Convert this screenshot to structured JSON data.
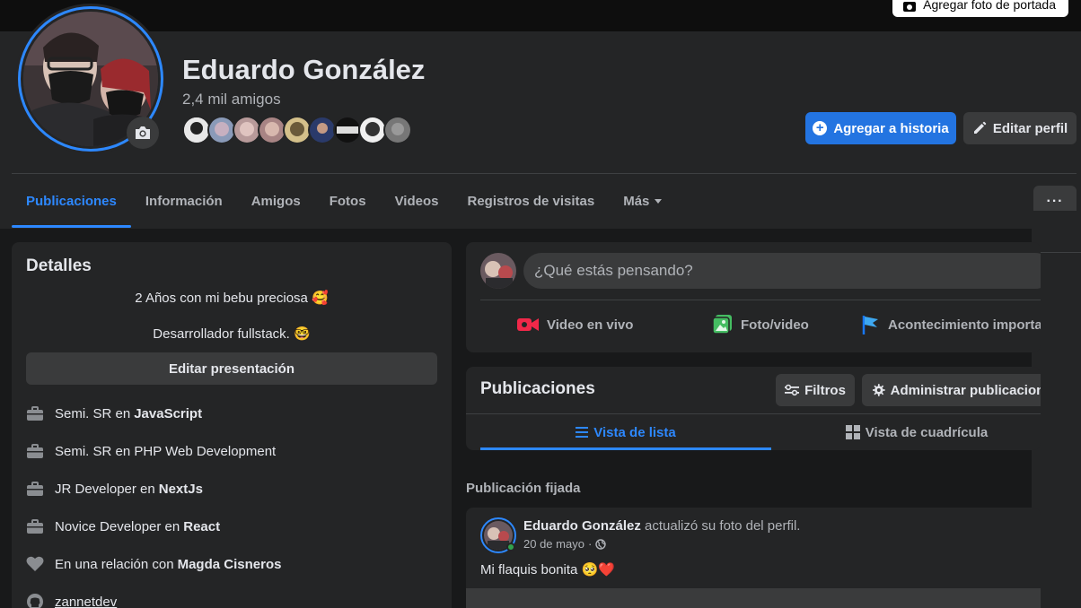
{
  "cover": {
    "button_label": "Agregar foto de portada"
  },
  "profile": {
    "name": "Eduardo González",
    "friends": "2,4 mil amigos"
  },
  "actions": {
    "add_story": "Agregar a historia",
    "edit_profile": "Editar perfil"
  },
  "tabs": [
    {
      "label": "Publicaciones",
      "active": true
    },
    {
      "label": "Información"
    },
    {
      "label": "Amigos"
    },
    {
      "label": "Fotos"
    },
    {
      "label": "Videos"
    },
    {
      "label": "Registros de visitas"
    },
    {
      "label": "Más"
    }
  ],
  "more_button": "···",
  "details": {
    "title": "Detalles",
    "bio": [
      "2 Años con mi bebu preciosa 🥰",
      "Desarrollador fullstack. 🤓"
    ],
    "edit_bio": "Editar presentación",
    "items": [
      {
        "icon": "briefcase-icon",
        "prefix": "Semi. SR en",
        "bold": "JavaScript"
      },
      {
        "icon": "briefcase-icon",
        "prefix": "Semi. SR en PHP Web Development",
        "bold": ""
      },
      {
        "icon": "briefcase-icon",
        "prefix": "JR Developer en",
        "bold": "NextJs"
      },
      {
        "icon": "briefcase-icon",
        "prefix": "Novice Developer en",
        "bold": "React"
      },
      {
        "icon": "heart-icon",
        "prefix": "En una relación con",
        "bold": "Magda Cisneros"
      },
      {
        "icon": "github-icon",
        "prefix": "zannetdev",
        "bold": ""
      }
    ]
  },
  "composer": {
    "placeholder": "¿Qué estás pensando?",
    "live": "Video en vivo",
    "photo": "Foto/video",
    "event": "Acontecimiento importante"
  },
  "posts": {
    "title": "Publicaciones",
    "filters": "Filtros",
    "manage": "Administrar publicaciones",
    "list_view": "Vista de lista",
    "grid_view": "Vista de cuadrícula"
  },
  "pinned": {
    "label": "Publicación fijada",
    "author": "Eduardo González",
    "action": "actualizó su foto del perfil.",
    "date": "20 de mayo",
    "text": "Mi flaquis bonita 🥺❤️"
  },
  "colors": {
    "accent": "#2d88ff",
    "primary_button": "#2374e1",
    "surface": "#242526",
    "background": "#18191a"
  }
}
